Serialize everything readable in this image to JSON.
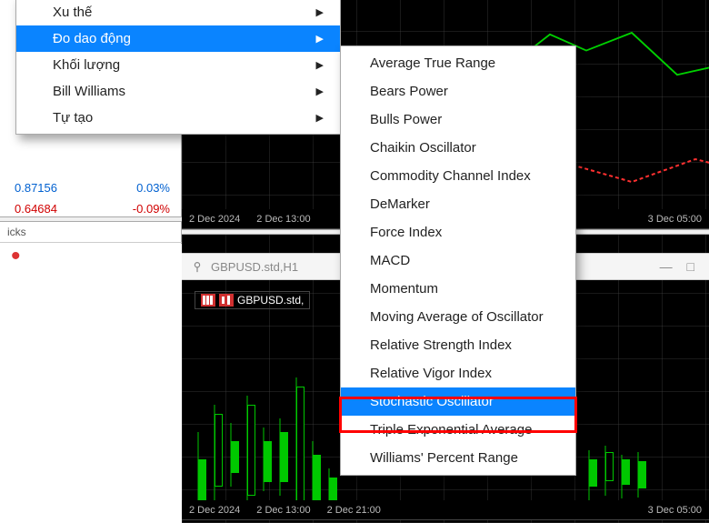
{
  "market_watch": {
    "rows": [
      {
        "price": "0.87156",
        "change": "0.03%",
        "cls": "blue"
      },
      {
        "price": "0.64684",
        "change": "-0.09%",
        "cls": "red"
      }
    ],
    "tab_label": "icks"
  },
  "chart_top": {
    "time_labels": [
      "2 Dec 2024",
      "2 Dec 13:00",
      "3 Dec 05:00"
    ]
  },
  "chart_tab": {
    "symbol": "GBPUSD.std,H1",
    "window_controls": "—  □"
  },
  "chart_overlay": {
    "label": "GBPUSD.std,"
  },
  "chart_bottom": {
    "time_labels": [
      "2 Dec 2024",
      "2 Dec 13:00",
      "2 Dec 21:00",
      "3 Dec 05:00"
    ]
  },
  "menu1": {
    "items": [
      {
        "label": "Xu thế",
        "hl": false
      },
      {
        "label": "Đo dao động",
        "hl": true
      },
      {
        "label": "Khối lượng",
        "hl": false
      },
      {
        "label": "Bill Williams",
        "hl": false
      },
      {
        "label": "Tự tạo",
        "hl": false
      }
    ]
  },
  "menu2": {
    "items": [
      {
        "label": "Average True Range",
        "hl": false
      },
      {
        "label": "Bears Power",
        "hl": false
      },
      {
        "label": "Bulls Power",
        "hl": false
      },
      {
        "label": "Chaikin Oscillator",
        "hl": false
      },
      {
        "label": "Commodity Channel Index",
        "hl": false
      },
      {
        "label": "DeMarker",
        "hl": false
      },
      {
        "label": "Force Index",
        "hl": false
      },
      {
        "label": "MACD",
        "hl": false
      },
      {
        "label": "Momentum",
        "hl": false
      },
      {
        "label": "Moving Average of Oscillator",
        "hl": false
      },
      {
        "label": "Relative Strength Index",
        "hl": false
      },
      {
        "label": "Relative Vigor Index",
        "hl": false
      },
      {
        "label": "Stochastic Oscillator",
        "hl": true
      },
      {
        "label": "Triple Exponential Average",
        "hl": false
      },
      {
        "label": "Williams' Percent Range",
        "hl": false
      }
    ]
  }
}
